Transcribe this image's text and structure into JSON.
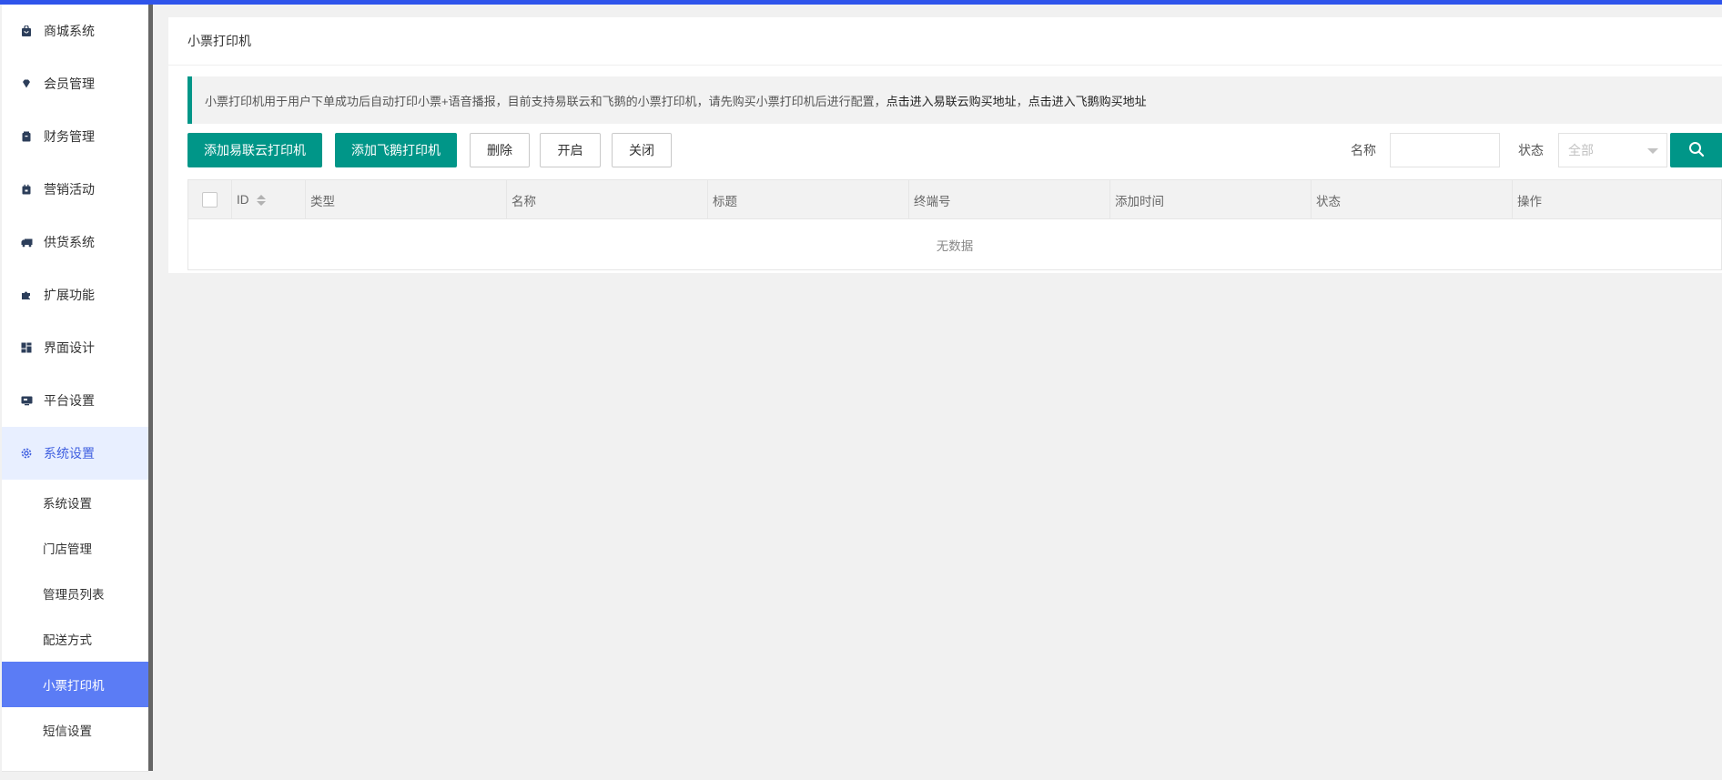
{
  "sidebar": {
    "items": [
      {
        "label": "商城系统",
        "icon": "shopping-bag-icon"
      },
      {
        "label": "会员管理",
        "icon": "diamond-icon"
      },
      {
        "label": "财务管理",
        "icon": "wallet-icon"
      },
      {
        "label": "营销活动",
        "icon": "calendar-icon"
      },
      {
        "label": "供货系统",
        "icon": "truck-icon"
      },
      {
        "label": "扩展功能",
        "icon": "puzzle-icon"
      },
      {
        "label": "界面设计",
        "icon": "layout-icon"
      },
      {
        "label": "平台设置",
        "icon": "monitor-icon"
      },
      {
        "label": "系统设置",
        "icon": "gear-icon"
      }
    ],
    "sub_items": [
      {
        "label": "系统设置"
      },
      {
        "label": "门店管理"
      },
      {
        "label": "管理员列表"
      },
      {
        "label": "配送方式"
      },
      {
        "label": "小票打印机"
      },
      {
        "label": "短信设置"
      }
    ]
  },
  "panel": {
    "title": "小票打印机",
    "notice": {
      "text": "小票打印机用于用户下单成功后自动打印小票+语音播报，目前支持易联云和飞鹅的小票打印机，请先购买小票打印机后进行配置，",
      "link1": "点击进入易联云购买地址",
      "separator": "，",
      "link2": "点击进入飞鹅购买地址"
    },
    "toolbar": {
      "add_yilianyun": "添加易联云打印机",
      "add_feie": "添加飞鹅打印机",
      "delete": "删除",
      "enable": "开启",
      "disable": "关闭",
      "name_label": "名称",
      "name_value": "",
      "status_label": "状态",
      "status_selected": "全部"
    },
    "table": {
      "columns": [
        "ID",
        "类型",
        "名称",
        "标题",
        "终端号",
        "添加时间",
        "状态",
        "操作"
      ],
      "rows": [],
      "empty_text": "无数据"
    }
  },
  "colors": {
    "topbar": "#2f54eb",
    "primary": "#009688",
    "active_sub": "#5b7cf5",
    "active_parent_bg": "#e8efff"
  }
}
